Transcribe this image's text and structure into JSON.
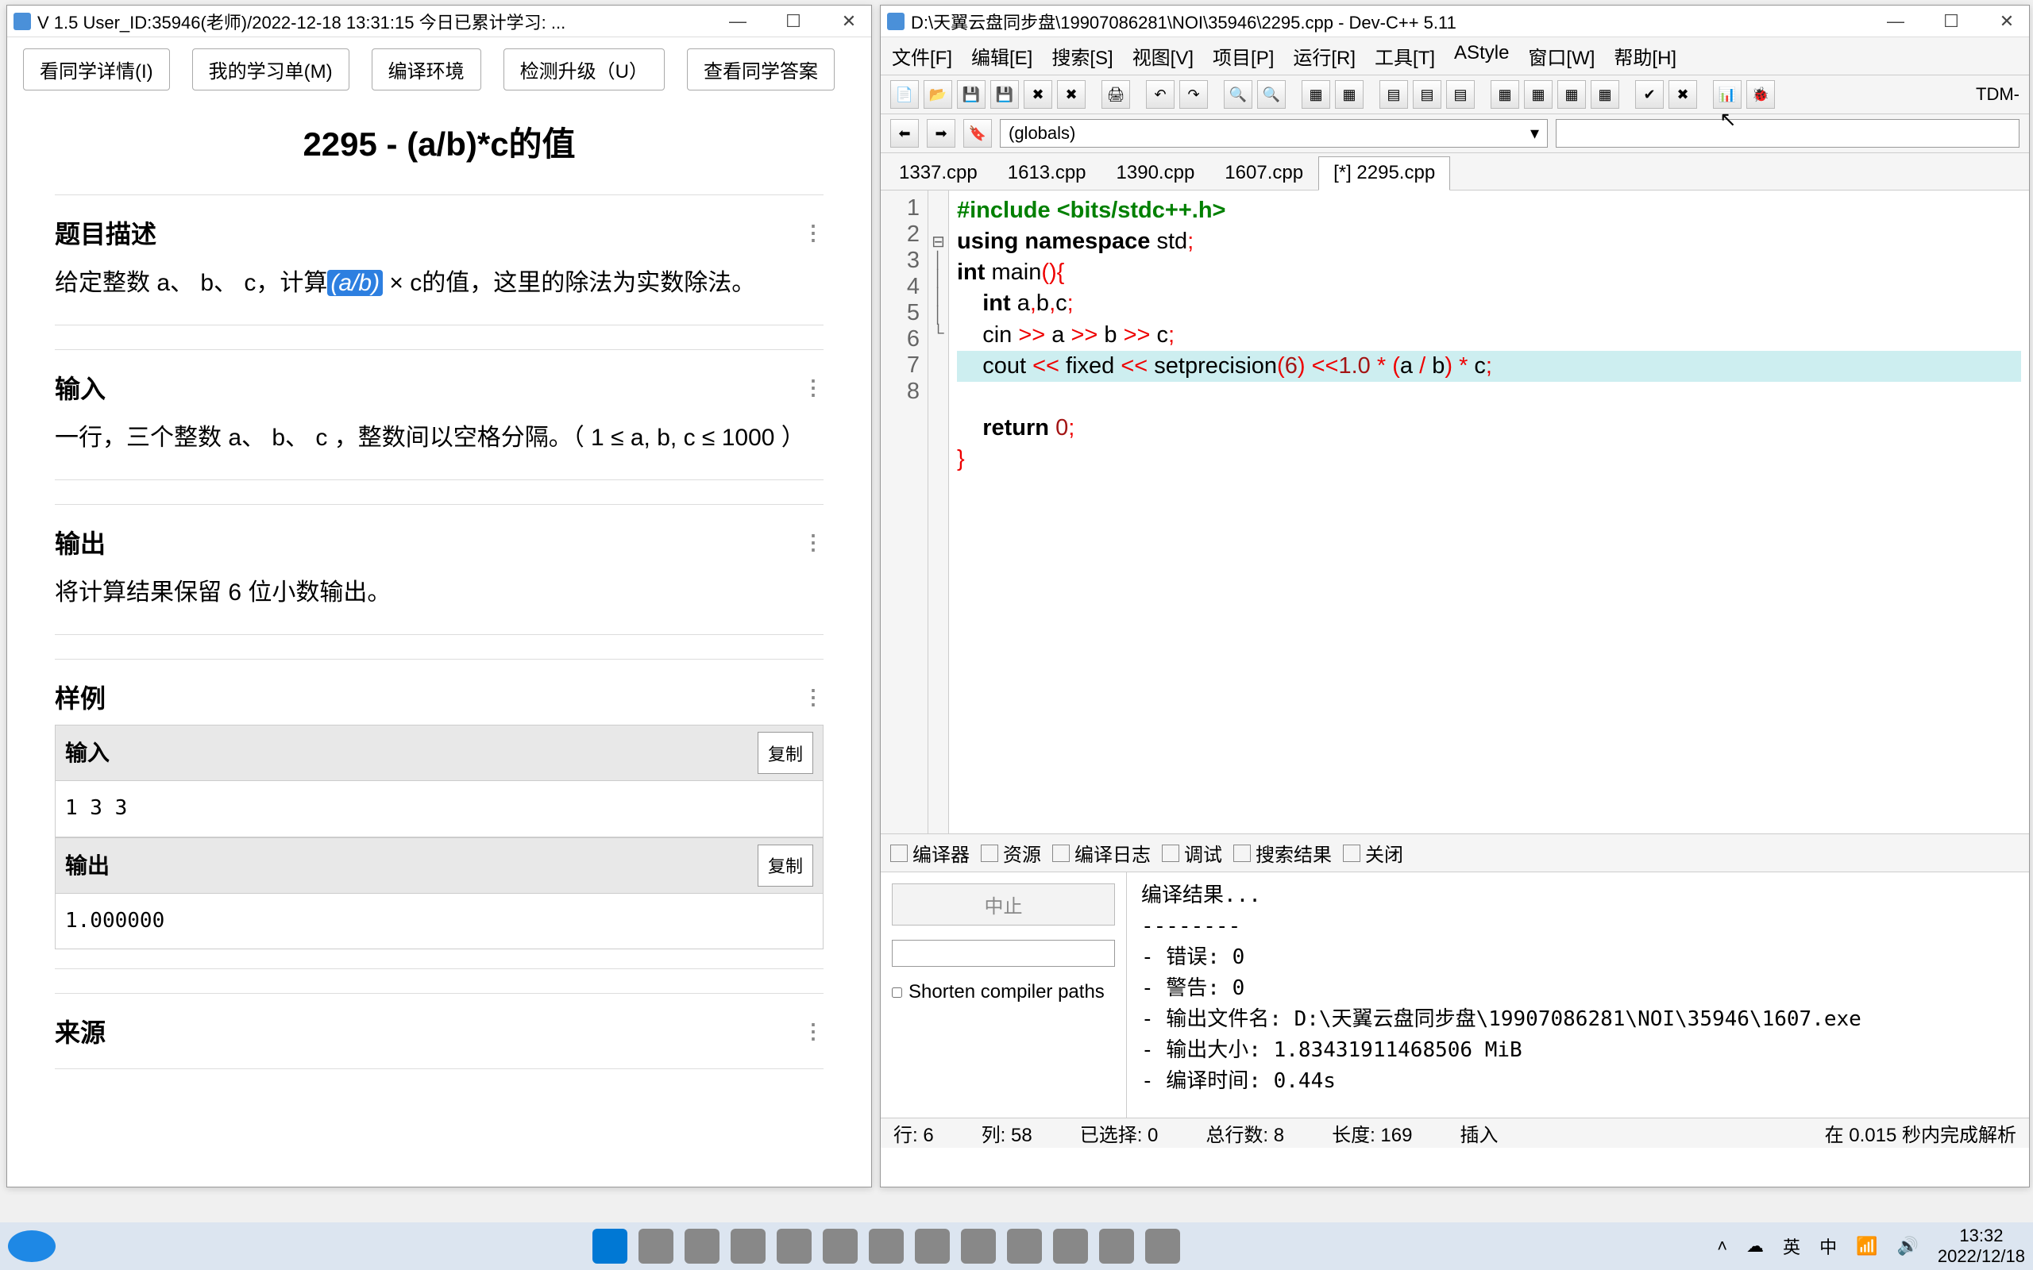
{
  "leftWin": {
    "title": "V 1.5 User_ID:35946(老师)/2022-12-18 13:31:15 今日已累计学习: ...",
    "buttons": [
      "看同学详情(I)",
      "我的学习单(M)",
      "编译环境",
      "检测升级（U）",
      "查看同学答案"
    ],
    "problemTitle": "2295 - (a/b)*c的值",
    "sections": {
      "desc": {
        "h": "题目描述",
        "body_pre": "给定整数 a、 b、 c，计算",
        "hl": "(a/b)",
        "body_post": " × c的值，这里的除法为实数除法。"
      },
      "input": {
        "h": "输入",
        "body": "一行，三个整数 a、 b、 c ，整数间以空格分隔。（ 1 ≤ a, b, c ≤ 1000 ）"
      },
      "output": {
        "h": "输出",
        "body": "将计算结果保留 6 位小数输出。"
      },
      "sample": {
        "h": "样例",
        "inLabel": "输入",
        "inData": "1 3 3",
        "outLabel": "输出",
        "outData": "1.000000",
        "copy": "复制"
      },
      "source": {
        "h": "来源"
      }
    }
  },
  "rightWin": {
    "title": "D:\\天翼云盘同步盘\\19907086281\\NOI\\35946\\2295.cpp - Dev-C++ 5.11",
    "menu": [
      "文件[F]",
      "编辑[E]",
      "搜索[S]",
      "视图[V]",
      "项目[P]",
      "运行[R]",
      "工具[T]",
      "AStyle",
      "窗口[W]",
      "帮助[H]"
    ],
    "scope": "(globals)",
    "tabs": [
      "1337.cpp",
      "1613.cpp",
      "1390.cpp",
      "1607.cpp",
      "[*] 2295.cpp"
    ],
    "activeTab": 4,
    "code": {
      "lines": [
        "1",
        "2",
        "3",
        "4",
        "5",
        "6",
        "7",
        "8"
      ]
    },
    "bottomTabs": [
      "编译器",
      "资源",
      "编译日志",
      "调试",
      "搜索结果",
      "关闭"
    ],
    "stopLabel": "中止",
    "shorten": "Shorten compiler paths",
    "compileOut": "编译结果...\n--------\n- 错误: 0\n- 警告: 0\n- 输出文件名: D:\\天翼云盘同步盘\\19907086281\\NOI\\35946\\1607.exe\n- 输出大小: 1.83431911468506 MiB\n- 编译时间: 0.44s",
    "status": {
      "row": "行:   6",
      "col": "列:   58",
      "sel": "已选择:   0",
      "total": "总行数:   8",
      "len": "长度:   169",
      "mode": "插入",
      "parse": "在 0.015 秒内完成解析"
    },
    "compiler": "TDM-"
  },
  "taskbar": {
    "time": "13:32",
    "date": "2022/12/18",
    "lang1": "英",
    "lang2": "中"
  }
}
